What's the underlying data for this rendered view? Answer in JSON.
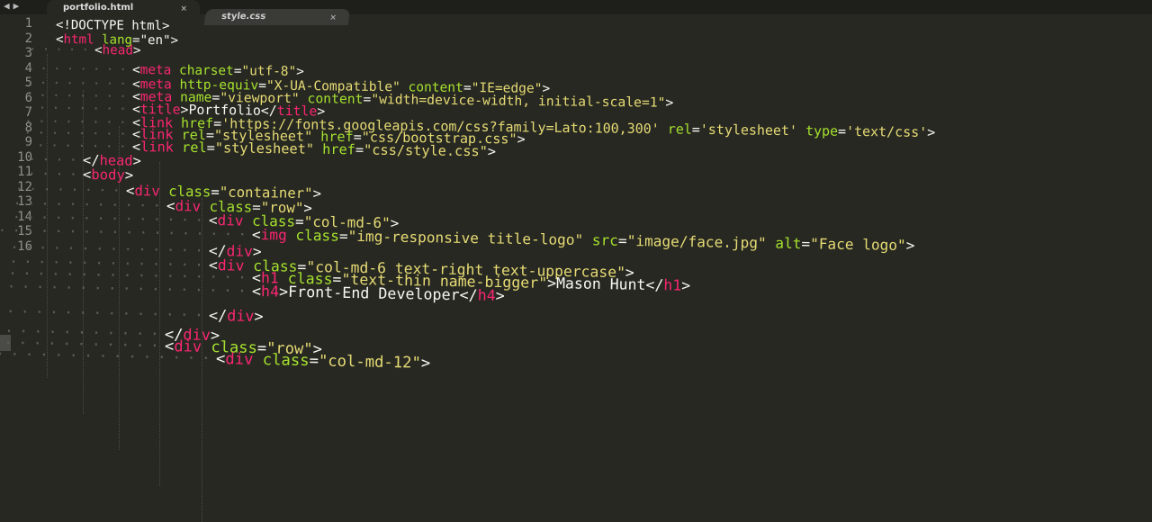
{
  "nav": {
    "back_icon": "◀",
    "forward_icon": "▶"
  },
  "tabs": [
    {
      "label": "portfolio.html",
      "close": "×"
    },
    {
      "label": "style.css",
      "close": "×"
    }
  ],
  "line_numbers": [
    "1",
    "2",
    "3",
    "4",
    "5",
    "6",
    "7",
    "8",
    "9",
    "10",
    "11",
    "12",
    "13",
    "14",
    "15",
    "16"
  ],
  "colors": {
    "background": "#272822",
    "tag": "#f92672",
    "attribute": "#a6e22e",
    "string": "#e6db74",
    "text": "#f8f8f2"
  },
  "code": [
    [
      [
        "<!DOCTYPE html>",
        "plain"
      ]
    ],
    [
      [
        "<",
        "plain"
      ],
      [
        "html",
        "tag"
      ],
      [
        " lang",
        "attr"
      ],
      [
        "=\"en\">",
        "plain"
      ]
    ],
    [
      [
        "<",
        "plain"
      ],
      [
        "head",
        "tag"
      ],
      [
        ">",
        "plain"
      ]
    ],
    [
      [
        "<",
        "plain"
      ],
      [
        "meta",
        "tag"
      ],
      [
        " charset",
        "attr"
      ],
      [
        "=",
        "plain"
      ],
      [
        "\"utf-8\"",
        "str"
      ],
      [
        ">",
        "plain"
      ]
    ],
    [
      [
        "<",
        "plain"
      ],
      [
        "meta",
        "tag"
      ],
      [
        " http-equiv",
        "attr"
      ],
      [
        "=",
        "plain"
      ],
      [
        "\"X-UA-Compatible\"",
        "str"
      ],
      [
        " content",
        "attr"
      ],
      [
        "=",
        "plain"
      ],
      [
        "\"IE=edge\"",
        "str"
      ],
      [
        ">",
        "plain"
      ]
    ],
    [
      [
        "<",
        "plain"
      ],
      [
        "meta",
        "tag"
      ],
      [
        " name",
        "attr"
      ],
      [
        "=",
        "plain"
      ],
      [
        "\"viewport\"",
        "str"
      ],
      [
        " content",
        "attr"
      ],
      [
        "=",
        "plain"
      ],
      [
        "\"width=device-width, initial-scale=1\"",
        "str"
      ],
      [
        ">",
        "plain"
      ]
    ],
    [
      [
        "<",
        "plain"
      ],
      [
        "title",
        "tag"
      ],
      [
        ">Portfolio</",
        "plain"
      ],
      [
        "title",
        "tag"
      ],
      [
        ">",
        "plain"
      ]
    ],
    [
      [
        "<",
        "plain"
      ],
      [
        "link",
        "tag"
      ],
      [
        " href",
        "attr"
      ],
      [
        "=",
        "plain"
      ],
      [
        "'https://fonts.googleapis.com/css?family=Lato:100,300'",
        "str"
      ],
      [
        " rel",
        "attr"
      ],
      [
        "=",
        "plain"
      ],
      [
        "'stylesheet'",
        "str"
      ],
      [
        " type",
        "attr"
      ],
      [
        "=",
        "plain"
      ],
      [
        "'text/css'",
        "str"
      ],
      [
        ">",
        "plain"
      ]
    ],
    [
      [
        "<",
        "plain"
      ],
      [
        "link",
        "tag"
      ],
      [
        " rel",
        "attr"
      ],
      [
        "=",
        "plain"
      ],
      [
        "\"stylesheet\"",
        "str"
      ],
      [
        " href",
        "attr"
      ],
      [
        "=",
        "plain"
      ],
      [
        "\"css/bootstrap.css\"",
        "str"
      ],
      [
        ">",
        "plain"
      ]
    ],
    [
      [
        "<",
        "plain"
      ],
      [
        "link",
        "tag"
      ],
      [
        " rel",
        "attr"
      ],
      [
        "=",
        "plain"
      ],
      [
        "\"stylesheet\"",
        "str"
      ],
      [
        " href",
        "attr"
      ],
      [
        "=",
        "plain"
      ],
      [
        "\"css/style.css\"",
        "str"
      ],
      [
        ">",
        "plain"
      ]
    ],
    [
      [
        "</",
        "plain"
      ],
      [
        "head",
        "tag"
      ],
      [
        ">",
        "plain"
      ]
    ],
    [
      [
        "<",
        "plain"
      ],
      [
        "body",
        "tag"
      ],
      [
        ">",
        "plain"
      ]
    ],
    [
      [
        "<",
        "plain"
      ],
      [
        "div",
        "tag"
      ],
      [
        " class",
        "attr"
      ],
      [
        "=",
        "plain"
      ],
      [
        "\"container\"",
        "str"
      ],
      [
        ">",
        "plain"
      ]
    ],
    [
      [
        "<",
        "plain"
      ],
      [
        "div",
        "tag"
      ],
      [
        " class",
        "attr"
      ],
      [
        "=",
        "plain"
      ],
      [
        "\"row\"",
        "str"
      ],
      [
        ">",
        "plain"
      ]
    ],
    [
      [
        "<",
        "plain"
      ],
      [
        "div",
        "tag"
      ],
      [
        " class",
        "attr"
      ],
      [
        "=",
        "plain"
      ],
      [
        "\"col-md-6\"",
        "str"
      ],
      [
        ">",
        "plain"
      ]
    ],
    [
      [
        "<",
        "plain"
      ],
      [
        "img",
        "tag"
      ],
      [
        " class",
        "attr"
      ],
      [
        "=",
        "plain"
      ],
      [
        "\"img-responsive title-logo\"",
        "str"
      ],
      [
        " src",
        "attr"
      ],
      [
        "=",
        "plain"
      ],
      [
        "\"image/face.jpg\"",
        "str"
      ],
      [
        " alt",
        "attr"
      ],
      [
        "=",
        "plain"
      ],
      [
        "\"Face logo\"",
        "str"
      ],
      [
        ">",
        "plain"
      ]
    ],
    [
      [
        "</",
        "plain"
      ],
      [
        "div",
        "tag"
      ],
      [
        ">",
        "plain"
      ]
    ],
    [
      [
        "<",
        "plain"
      ],
      [
        "div",
        "tag"
      ],
      [
        " class",
        "attr"
      ],
      [
        "=",
        "plain"
      ],
      [
        "\"col-md-6 text-right text-uppercase\"",
        "str"
      ],
      [
        ">",
        "plain"
      ]
    ],
    [
      [
        "<",
        "plain"
      ],
      [
        "h1",
        "tag"
      ],
      [
        " class",
        "attr"
      ],
      [
        "=",
        "plain"
      ],
      [
        "\"text-thin name-bigger\"",
        "str"
      ],
      [
        ">Mason Hunt</",
        "plain"
      ],
      [
        "h1",
        "tag"
      ],
      [
        ">",
        "plain"
      ]
    ],
    [
      [
        "<",
        "plain"
      ],
      [
        "h4",
        "tag"
      ],
      [
        ">Front-End Developer</",
        "plain"
      ],
      [
        "h4",
        "tag"
      ],
      [
        ">",
        "plain"
      ]
    ],
    [
      [
        "</",
        "plain"
      ],
      [
        "div",
        "tag"
      ],
      [
        ">",
        "plain"
      ]
    ],
    [
      [
        "</",
        "plain"
      ],
      [
        "div",
        "tag"
      ],
      [
        ">",
        "plain"
      ]
    ],
    [
      [
        "<",
        "plain"
      ],
      [
        "div",
        "tag"
      ],
      [
        " class",
        "attr"
      ],
      [
        "=",
        "plain"
      ],
      [
        "\"row\"",
        "str"
      ],
      [
        ">",
        "plain"
      ]
    ],
    [
      [
        "<",
        "plain"
      ],
      [
        "div",
        "tag"
      ],
      [
        " class",
        "attr"
      ],
      [
        "=",
        "plain"
      ],
      [
        "\"col-md-12\"",
        "str"
      ],
      [
        ">",
        "plain"
      ]
    ]
  ]
}
